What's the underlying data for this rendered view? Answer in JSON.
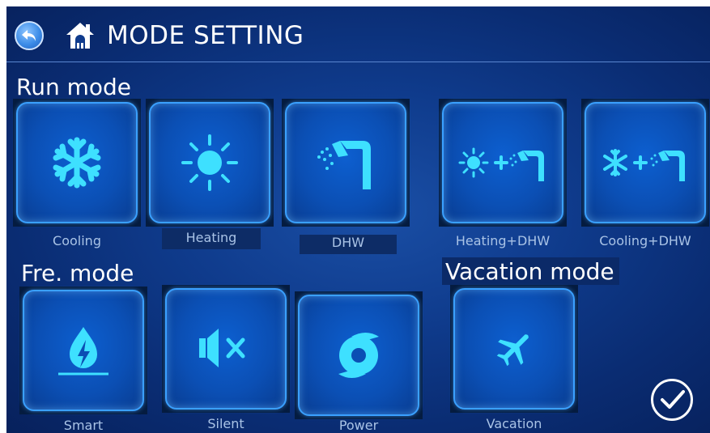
{
  "header": {
    "title": "MODE SETTING"
  },
  "run_mode": {
    "label": "Run mode",
    "modes": [
      {
        "label": "Cooling",
        "icon": "snowflake-icon"
      },
      {
        "label": "Heating",
        "icon": "sun-icon"
      },
      {
        "label": "DHW",
        "icon": "shower-icon"
      },
      {
        "label": "Heating+DHW",
        "icon": "sun-plus-shower-icon"
      },
      {
        "label": "Cooling+DHW",
        "icon": "snowflake-plus-shower-icon"
      }
    ]
  },
  "fre_mode": {
    "label": "Fre. mode",
    "modes": [
      {
        "label": "Smart",
        "icon": "eco-drop-icon"
      },
      {
        "label": "Silent",
        "icon": "mute-speaker-icon"
      },
      {
        "label": "Power",
        "icon": "typhoon-icon"
      }
    ]
  },
  "vacation_mode": {
    "label": "Vacation mode",
    "modes": [
      {
        "label": "Vacation",
        "icon": "airplane-icon"
      }
    ]
  },
  "colors": {
    "background": "#0f3b8c",
    "tile_border": "#3aa0ff",
    "icon": "#3ee0ff",
    "caption": "#a9c3e6"
  }
}
